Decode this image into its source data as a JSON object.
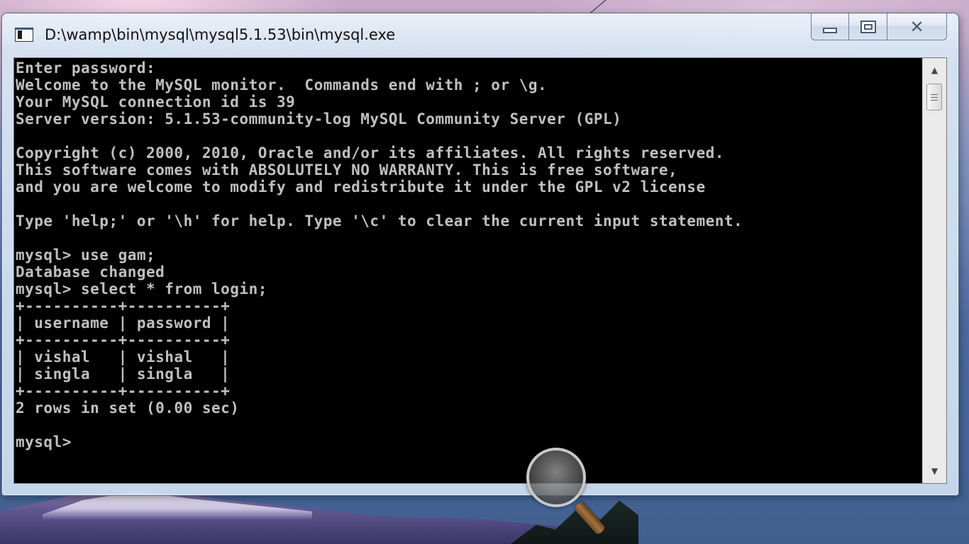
{
  "window": {
    "title": "D:\\wamp\\bin\\mysql\\mysql5.1.53\\bin\\mysql.exe",
    "icon": "console-window-icon",
    "controls": {
      "minimize": "minimize-icon",
      "maximize": "maximize-icon",
      "close": "close-icon",
      "close_glyph": "✕"
    }
  },
  "console": {
    "text_color": "#c0c0c0",
    "background_color": "#000000",
    "lines": [
      "Enter password:",
      "Welcome to the MySQL monitor.  Commands end with ; or \\g.",
      "Your MySQL connection id is 39",
      "Server version: 5.1.53-community-log MySQL Community Server (GPL)",
      "",
      "Copyright (c) 2000, 2010, Oracle and/or its affiliates. All rights reserved.",
      "This software comes with ABSOLUTELY NO WARRANTY. This is free software,",
      "and you are welcome to modify and redistribute it under the GPL v2 license",
      "",
      "Type 'help;' or '\\h' for help. Type '\\c' to clear the current input statement.",
      "",
      "mysql> use gam;",
      "Database changed",
      "mysql> select * from login;",
      "+----------+----------+",
      "| username | password |",
      "+----------+----------+",
      "| vishal   | vishal   |",
      "| singla   | singla   |",
      "+----------+----------+",
      "2 rows in set (0.00 sec)",
      "",
      "mysql>"
    ]
  },
  "scrollbar": {
    "up_arrow": "▲",
    "down_arrow": "▼"
  },
  "desktop": {
    "magnifier": "magnifier-icon"
  }
}
